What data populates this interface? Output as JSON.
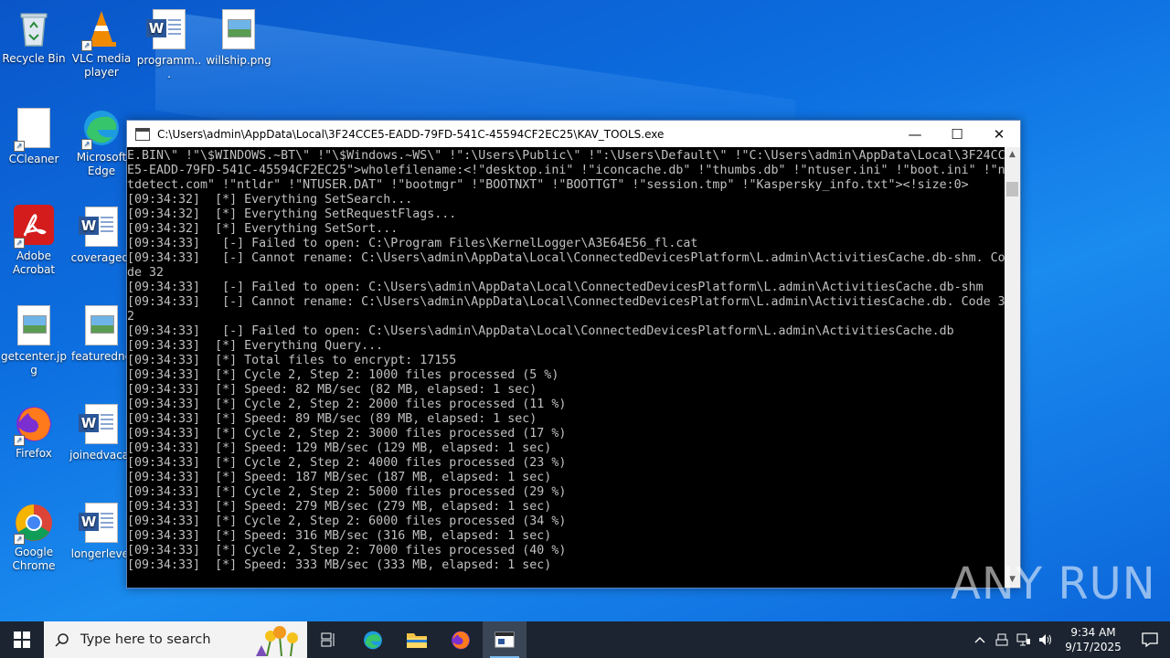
{
  "desktop": {
    "icons": [
      {
        "label": "Recycle Bin"
      },
      {
        "label": "VLC media player"
      },
      {
        "label": "programm..."
      },
      {
        "label": "willship.png"
      },
      {
        "label": "CCleaner"
      },
      {
        "label": "Microsoft Edge"
      },
      {
        "label": "Adobe Acrobat"
      },
      {
        "label": "coveragedi"
      },
      {
        "label": "getcenter.jpg"
      },
      {
        "label": "featuredne"
      },
      {
        "label": "Firefox"
      },
      {
        "label": "joinedvacat"
      },
      {
        "label": "Google Chrome"
      },
      {
        "label": "longerlevel"
      }
    ]
  },
  "window": {
    "title": "C:\\Users\\admin\\AppData\\Local\\3F24CCE5-EADD-79FD-541C-45594CF2EC25\\KAV_TOOLS.exe",
    "buttons": {
      "minimize": "—",
      "maximize": "☐",
      "close": "✕"
    },
    "console_text": "E.BIN\\\" !\"\\$WINDOWS.~BT\\\" !\"\\$Windows.~WS\\\" !\":\\Users\\Public\\\" !\":\\Users\\Default\\\" !\"C:\\Users\\admin\\AppData\\Local\\3F24CC\nE5-EADD-79FD-541C-45594CF2EC25\">wholefilename:<!\"desktop.ini\" !\"iconcache.db\" !\"thumbs.db\" !\"ntuser.ini\" !\"boot.ini\" !\"n\ntdetect.com\" !\"ntldr\" !\"NTUSER.DAT\" !\"bootmgr\" !\"BOOTNXT\" !\"BOOTTGT\" !\"session.tmp\" !\"Kaspersky_info.txt\"><!size:0>\n[09:34:32]  [*] Everything SetSearch...\n[09:34:32]  [*] Everything SetRequestFlags...\n[09:34:32]  [*] Everything SetSort...\n[09:34:33]   [-] Failed to open: C:\\Program Files\\KernelLogger\\A3E64E56_fl.cat\n[09:34:33]   [-] Cannot rename: C:\\Users\\admin\\AppData\\Local\\ConnectedDevicesPlatform\\L.admin\\ActivitiesCache.db-shm. Co\nde 32\n[09:34:33]   [-] Failed to open: C:\\Users\\admin\\AppData\\Local\\ConnectedDevicesPlatform\\L.admin\\ActivitiesCache.db-shm\n[09:34:33]   [-] Cannot rename: C:\\Users\\admin\\AppData\\Local\\ConnectedDevicesPlatform\\L.admin\\ActivitiesCache.db. Code 3\n2\n[09:34:33]   [-] Failed to open: C:\\Users\\admin\\AppData\\Local\\ConnectedDevicesPlatform\\L.admin\\ActivitiesCache.db\n[09:34:33]  [*] Everything Query...\n[09:34:33]  [*] Total files to encrypt: 17155\n[09:34:33]  [*] Cycle 2, Step 2: 1000 files processed (5 %)\n[09:34:33]  [*] Speed: 82 MB/sec (82 MB, elapsed: 1 sec)\n[09:34:33]  [*] Cycle 2, Step 2: 2000 files processed (11 %)\n[09:34:33]  [*] Speed: 89 MB/sec (89 MB, elapsed: 1 sec)\n[09:34:33]  [*] Cycle 2, Step 2: 3000 files processed (17 %)\n[09:34:33]  [*] Speed: 129 MB/sec (129 MB, elapsed: 1 sec)\n[09:34:33]  [*] Cycle 2, Step 2: 4000 files processed (23 %)\n[09:34:33]  [*] Speed: 187 MB/sec (187 MB, elapsed: 1 sec)\n[09:34:33]  [*] Cycle 2, Step 2: 5000 files processed (29 %)\n[09:34:33]  [*] Speed: 279 MB/sec (279 MB, elapsed: 1 sec)\n[09:34:33]  [*] Cycle 2, Step 2: 6000 files processed (34 %)\n[09:34:33]  [*] Speed: 316 MB/sec (316 MB, elapsed: 1 sec)\n[09:34:33]  [*] Cycle 2, Step 2: 7000 files processed (40 %)\n[09:34:33]  [*] Speed: 333 MB/sec (333 MB, elapsed: 1 sec)"
  },
  "watermark": {
    "text": "ANY RUN"
  },
  "taskbar": {
    "search_placeholder": "Type here to search",
    "clock": {
      "time": "9:34 AM",
      "date": "9/17/2025"
    }
  }
}
